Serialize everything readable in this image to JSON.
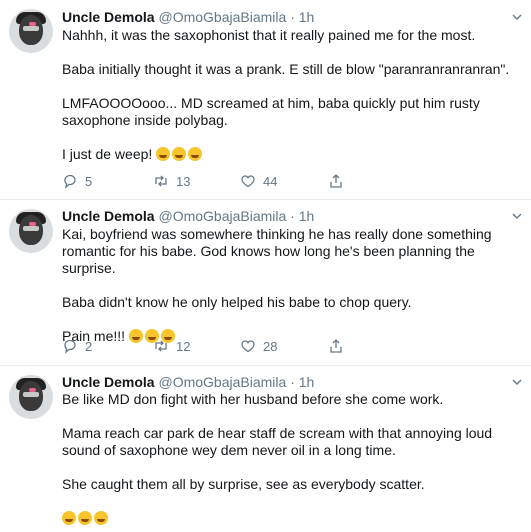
{
  "tweets": [
    {
      "name": "Uncle Demola",
      "handle": "@OmoGbajaBiamila",
      "time": "· 1h",
      "paragraphs": [
        "Nahhh, it was the saxophonist that it really pained me for the most.",
        "Baba initially thought it was a prank. E still de blow \"paranranranranran\".",
        "LMFAOOOOooo... MD screamed at him, baba quickly put him rusty saxophone inside polybag.",
        "I just de weep!"
      ],
      "emoji_count": 3,
      "replies": "5",
      "retweets": "13",
      "likes": "44"
    },
    {
      "name": "Uncle Demola",
      "handle": "@OmoGbajaBiamila",
      "time": "· 1h",
      "paragraphs": [
        "Kai, boyfriend was somewhere thinking he has really done something romantic for his babe. God knows how long he's been planning the surprise.",
        "Baba didn't know he only helped his babe to chop query.",
        "Pain me!!!"
      ],
      "emoji_count": 3,
      "replies": "2",
      "retweets": "12",
      "likes": "28"
    },
    {
      "name": "Uncle Demola",
      "handle": "@OmoGbajaBiamila",
      "time": "· 1h",
      "paragraphs": [
        "Be like MD don fight with her husband before she come work.",
        "Mama reach car park de hear staff de scream with that annoying loud sound of saxophone wey dem never oil in a long time.",
        "She caught them all by surprise, see as everybody scatter."
      ],
      "emoji_count": 3
    }
  ],
  "colors": {
    "text": "#14171a",
    "secondary": "#657786",
    "divider": "#e6ecf0"
  },
  "icons": [
    "reply-icon",
    "retweet-icon",
    "like-icon",
    "share-icon",
    "chevron-down-icon"
  ]
}
